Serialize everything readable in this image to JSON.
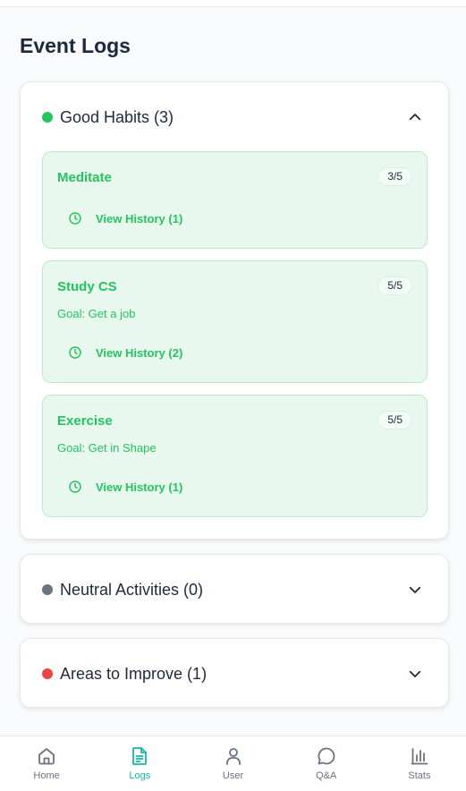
{
  "page": {
    "title": "Event Logs"
  },
  "colors": {
    "good": "#22c55e",
    "neutral": "#6b7280",
    "improve": "#ef4444",
    "accent": "#14b8a6"
  },
  "sections": [
    {
      "title": "Good Habits (3)",
      "expanded": true,
      "icon": "chevron-up-icon",
      "habits": [
        {
          "name": "Meditate",
          "badge": "3/5",
          "goal": "",
          "history": "View History (1)"
        },
        {
          "name": "Study CS",
          "badge": "5/5",
          "goal": "Goal: Get a job",
          "history": "View History (2)"
        },
        {
          "name": "Exercise",
          "badge": "5/5",
          "goal": "Goal: Get in Shape",
          "history": "View History (1)"
        }
      ]
    },
    {
      "title": "Neutral Activities (0)",
      "expanded": false,
      "icon": "chevron-down-icon"
    },
    {
      "title": "Areas to Improve (1)",
      "expanded": false,
      "icon": "chevron-down-icon"
    }
  ],
  "nav": [
    {
      "label": "Home",
      "icon": "home-icon",
      "active": false
    },
    {
      "label": "Logs",
      "icon": "document-icon",
      "active": true
    },
    {
      "label": "User",
      "icon": "user-icon",
      "active": false
    },
    {
      "label": "Q&A",
      "icon": "chat-bubble-icon",
      "active": false
    },
    {
      "label": "Stats",
      "icon": "bar-chart-icon",
      "active": false
    }
  ]
}
